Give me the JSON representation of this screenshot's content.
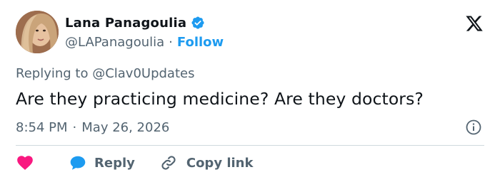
{
  "author": {
    "display_name": "Lana Panagoulia",
    "handle": "@LAPanagoulia",
    "separator": "·",
    "follow_label": "Follow",
    "verified": true
  },
  "tweet": {
    "replying_to": "Replying to @Clav0Updates",
    "text": "Are they practicing medicine? Are they doctors?",
    "time": "8:54 PM",
    "separator": "·",
    "date": "May 26, 2026"
  },
  "actions": {
    "reply_label": "Reply",
    "copy_link_label": "Copy link"
  },
  "icons": {
    "logo": "x-logo-icon",
    "verified": "verified-badge-icon",
    "info": "info-icon",
    "like": "heart-icon",
    "reply": "speech-bubble-icon",
    "copy_link": "link-icon"
  },
  "colors": {
    "accent": "#1d9bf0",
    "heart": "#f91880",
    "text": "#0f1419",
    "muted": "#536471",
    "divider": "#cfd9de"
  }
}
